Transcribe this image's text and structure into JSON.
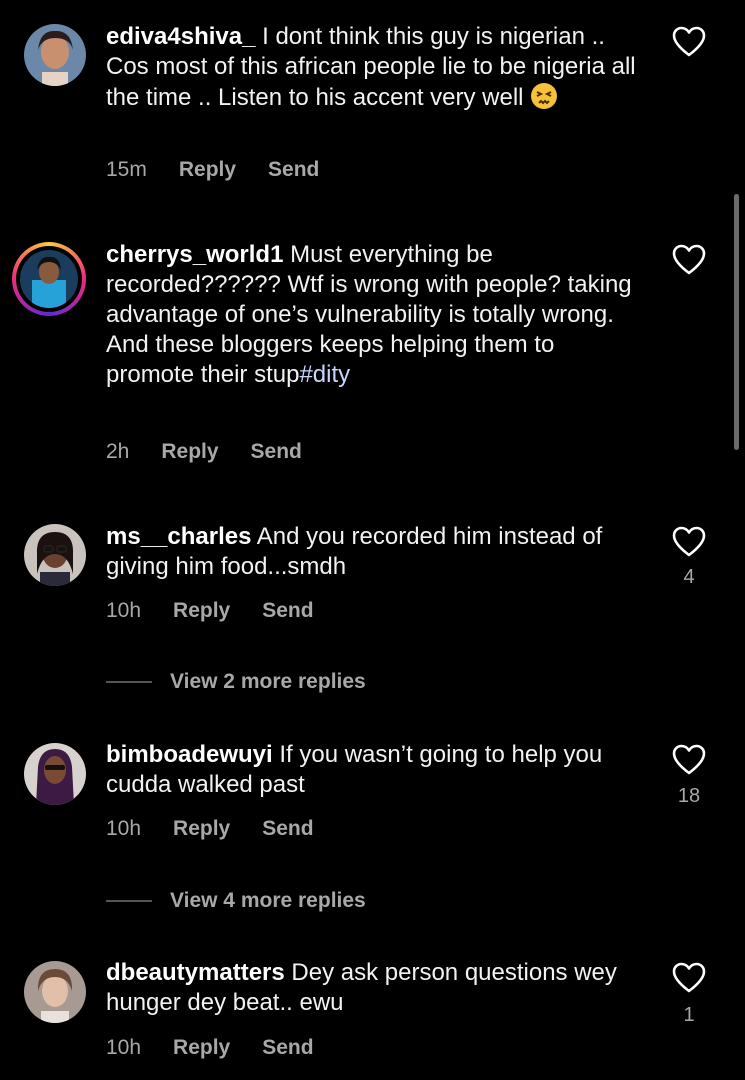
{
  "comments": [
    {
      "username": "ediva4shiva_",
      "text": " I dont think this guy is nigerian .. Cos most of this african people lie to be nigeria all the time .. Listen to his accent very well",
      "emoji": "persevering-face-emoji",
      "time": "15m",
      "reply": "Reply",
      "send": "Send",
      "likes": ""
    },
    {
      "username": "cherrys_world1",
      "text": " Must everything be recorded?????? Wtf is wrong with people? taking advantage of one’s vulnerability is totally wrong.\nAnd these bloggers keeps helping them to promote their stup",
      "hashtag": "#dity",
      "time": "2h",
      "reply": "Reply",
      "send": "Send",
      "likes": ""
    },
    {
      "username": "ms__charles",
      "text": " And you recorded him instead of giving him food...smdh",
      "time": "10h",
      "reply": "Reply",
      "send": "Send",
      "likes": "4",
      "view_replies": "View 2 more replies"
    },
    {
      "username": "bimboadewuyi",
      "text": " If you wasn’t going to help you cudda walked past",
      "time": "10h",
      "reply": "Reply",
      "send": "Send",
      "likes": "18",
      "view_replies": "View 4 more replies"
    },
    {
      "username": "dbeautymatters",
      "text": " Dey ask person questions wey hunger dey beat.. ewu",
      "time": "10h",
      "reply": "Reply",
      "send": "Send",
      "likes": "1"
    }
  ],
  "icons": {
    "heart": "heart-outline-icon"
  },
  "colors": {
    "background": "#000000",
    "secondary_text": "#a8a8a8",
    "hashtag": "#c8d6ff"
  }
}
